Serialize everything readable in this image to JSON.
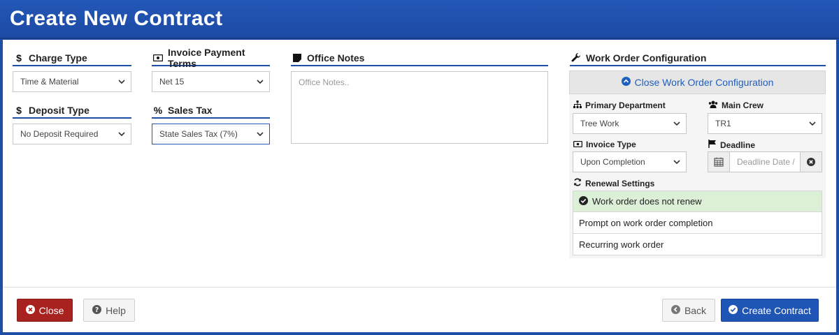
{
  "header": {
    "title": "Create New Contract"
  },
  "fields": {
    "charge_type": {
      "label": "Charge Type",
      "icon": "dollar-icon",
      "value": "Time & Material"
    },
    "invoice_payment_terms": {
      "label": "Invoice Payment Terms",
      "icon": "money-icon",
      "value": "Net 15"
    },
    "deposit_type": {
      "label": "Deposit Type",
      "icon": "dollar-icon",
      "value": "No Deposit Required"
    },
    "sales_tax": {
      "label": "Sales Tax",
      "icon": "percent-icon",
      "value": "State Sales Tax (7%)"
    },
    "office_notes": {
      "label": "Office Notes",
      "icon": "sticky-note-icon",
      "placeholder": "Office Notes.."
    }
  },
  "work_order": {
    "label": "Work Order Configuration",
    "icon": "wrench-icon",
    "toggle_label": "Close Work Order Configuration",
    "primary_department": {
      "label": "Primary Department",
      "value": "Tree Work"
    },
    "main_crew": {
      "label": "Main Crew",
      "value": "TR1"
    },
    "invoice_type": {
      "label": "Invoice Type",
      "value": "Upon Completion"
    },
    "deadline": {
      "label": "Deadline",
      "placeholder": "Deadline Date /"
    },
    "renewal": {
      "label": "Renewal Settings",
      "options": [
        {
          "label": "Work order does not renew",
          "active": true
        },
        {
          "label": "Prompt on work order completion",
          "active": false
        },
        {
          "label": "Recurring work order",
          "active": false
        }
      ]
    }
  },
  "footer": {
    "close_label": "Close",
    "help_label": "Help",
    "back_label": "Back",
    "create_label": "Create Contract"
  },
  "colors": {
    "brand": "#1f4ea8",
    "danger": "#a8231f",
    "primary": "#1f55b5",
    "success_bg": "#dcf0d8"
  }
}
